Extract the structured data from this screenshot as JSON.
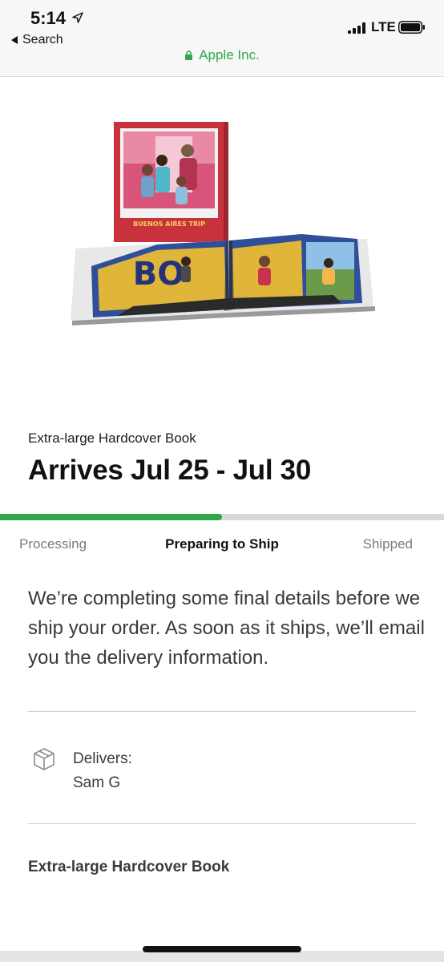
{
  "status_bar": {
    "time": "5:14",
    "back_label": "Search",
    "network": "LTE",
    "site": "Apple Inc."
  },
  "product": {
    "image_icon": "photo-book-image",
    "cover_text": "BUENOS AIRES TRIP",
    "name": "Extra-large Hardcover Book",
    "arrival": "Arrives Jul 25 - Jul 30"
  },
  "progress": {
    "fraction": 0.5,
    "steps": [
      {
        "label": "Processing",
        "active": false
      },
      {
        "label": "Preparing to Ship",
        "active": true
      },
      {
        "label": "Shipped",
        "active": false
      }
    ]
  },
  "message": "We’re completing some final details before we ship your order. As soon as it ships, we’ll email you the delivery information.",
  "delivery": {
    "icon": "box-icon",
    "label": "Delivers:",
    "name": "Sam G"
  },
  "item": {
    "title": "Extra-large Hardcover Book"
  },
  "colors": {
    "accent_green": "#2ea84a",
    "track_gray": "#d8d8d8"
  }
}
